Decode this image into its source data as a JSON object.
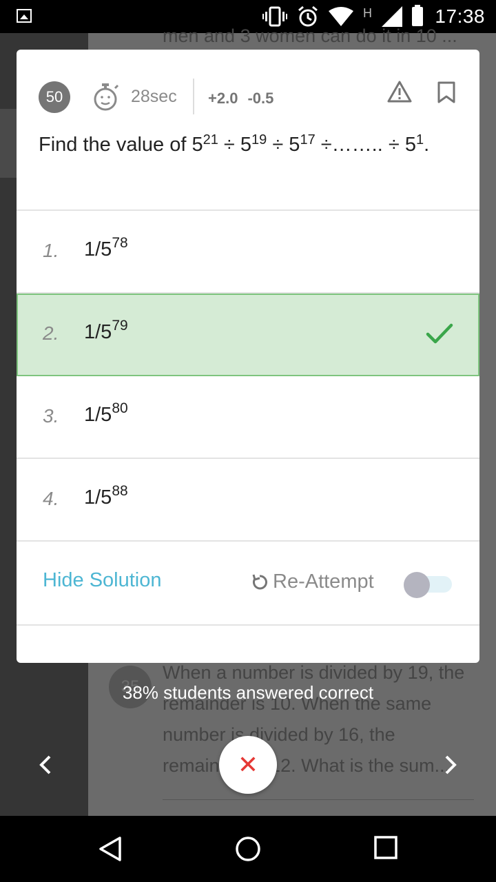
{
  "status_bar": {
    "time": "17:38",
    "network_letter": "H",
    "icons": [
      "gallery-icon",
      "vibrate-icon",
      "alarm-icon",
      "wifi-icon",
      "signal-icon",
      "battery-icon"
    ]
  },
  "background": {
    "top_text": "men and 3 women can do it in 10 ...",
    "next_question_number": "35",
    "next_question_text": "When a number is divided by 19, the remainder is 10. When the same number is divided by 16, the remainder is 12. What is the sum..."
  },
  "card": {
    "question_number": "50",
    "timer": "28sec",
    "marks_positive": "+2.0",
    "marks_negative": "-0.5",
    "question": {
      "prefix": "Find the value of 5",
      "exp1": "21",
      "mid1": " ÷ 5",
      "exp2": "19",
      "mid2": " ÷ 5",
      "exp3": "17",
      "mid3": " ÷…….. ÷ 5",
      "exp4": "1",
      "suffix": "."
    },
    "options": [
      {
        "index": "1.",
        "base": "1/5",
        "exp": "78",
        "correct": false
      },
      {
        "index": "2.",
        "base": "1/5",
        "exp": "79",
        "correct": true
      },
      {
        "index": "3.",
        "base": "1/5",
        "exp": "80",
        "correct": false
      },
      {
        "index": "4.",
        "base": "1/5",
        "exp": "88",
        "correct": false
      }
    ],
    "hide_solution_label": "Hide Solution",
    "reattempt_label": "Re-Attempt",
    "reattempt_toggle_on": false
  },
  "footer": {
    "answered_text": "38% students answered correct",
    "prev_label": "‹",
    "next_label": "›",
    "close_label": "✕"
  },
  "colors": {
    "correct_bg": "#d5ebd5",
    "correct_border": "#7ec47e",
    "check": "#3aa64a",
    "link": "#4db6d3",
    "close": "#e53935"
  }
}
